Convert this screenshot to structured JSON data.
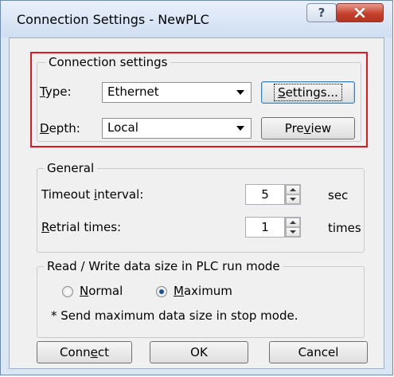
{
  "window": {
    "title": "Connection Settings - NewPLC",
    "help_label": "?",
    "close_label": "✕"
  },
  "connection": {
    "legend": "Connection settings",
    "type_label": "Type:",
    "type_value": "Ethernet",
    "depth_label": "Depth:",
    "depth_value": "Local",
    "settings_button": "Settings...",
    "preview_button": "Preview",
    "highlight_color": "#e4161f"
  },
  "general": {
    "legend": "General",
    "timeout_label": "Timeout interval:",
    "timeout_value": "5",
    "timeout_unit": "sec",
    "retrial_label": "Retrial times:",
    "retrial_value": "1",
    "retrial_unit": "times"
  },
  "data_size": {
    "legend": "Read / Write data size in PLC run mode",
    "option_normal": "Normal",
    "option_maximum": "Maximum",
    "selected": "Maximum",
    "note": "* Send maximum data size in stop mode."
  },
  "buttons": {
    "connect": "Connect",
    "ok": "OK",
    "cancel": "Cancel"
  }
}
